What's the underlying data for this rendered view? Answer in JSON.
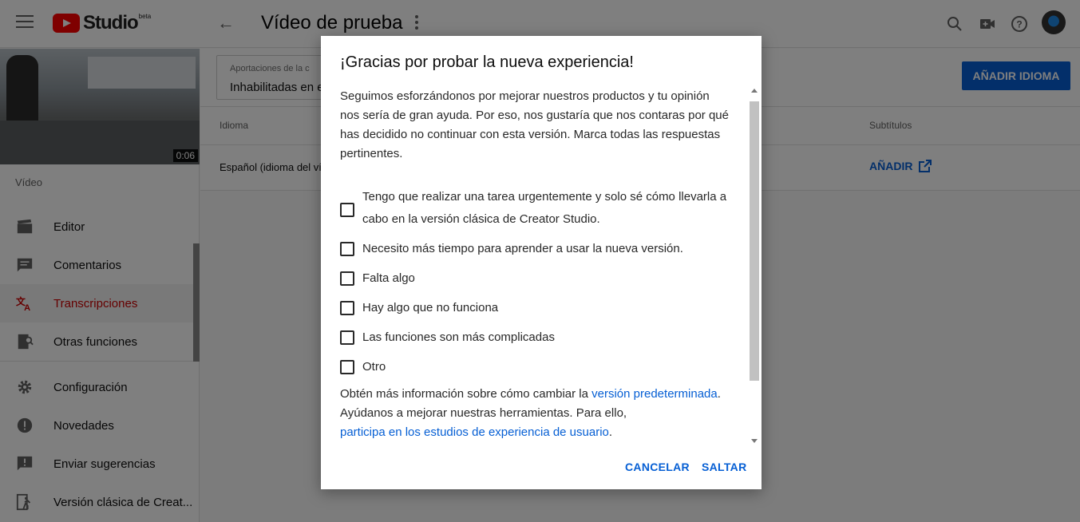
{
  "header": {
    "logo_text": "Studio",
    "logo_badge": "beta",
    "page_title": "Vídeo de prueba",
    "icons": [
      "menu-icon",
      "back-arrow-icon",
      "more-vert-icon",
      "search-icon",
      "create-video-icon",
      "help-icon",
      "avatar"
    ]
  },
  "sidebar": {
    "video_duration": "0:06",
    "section_label": "Vídeo",
    "items": [
      {
        "label": "Editor",
        "icon": "clapperboard-icon"
      },
      {
        "label": "Comentarios",
        "icon": "comment-icon"
      },
      {
        "label": "Transcripciones",
        "icon": "translate-icon",
        "active": true
      },
      {
        "label": "Otras funciones",
        "icon": "other-features-icon"
      },
      {
        "label": "Configuración",
        "icon": "gear-icon"
      },
      {
        "label": "Novedades",
        "icon": "new-badge-icon"
      },
      {
        "label": "Enviar sugerencias",
        "icon": "feedback-icon"
      },
      {
        "label": "Versión clásica de Creat...",
        "icon": "exit-classic-icon"
      }
    ]
  },
  "main": {
    "contributions_label": "Aportaciones de la c",
    "contributions_value": "Inhabilitadas en e",
    "add_language_button": "AÑADIR IDIOMA",
    "columns": {
      "language": "Idioma",
      "subtitles": "Subtítulos"
    },
    "row": {
      "language": "Español (idioma del ví",
      "action": "AÑADIR"
    }
  },
  "dialog": {
    "title": "¡Gracias por probar la nueva experiencia!",
    "intro": "Seguimos esforzándonos por mejorar nuestros productos y tu opinión nos sería de gran ayuda. Por eso, nos gustaría que nos contaras por qué has decidido no continuar con esta versión. Marca todas las respuestas pertinentes.",
    "options": [
      "Tengo que realizar una tarea urgentemente y solo sé cómo llevarla a cabo en la versión clásica de Creator Studio.",
      "Necesito más tiempo para aprender a usar la nueva versión.",
      "Falta algo",
      "Hay algo que no funciona",
      "Las funciones son más complicadas",
      "Otro"
    ],
    "info_prefix": "Obtén más información sobre cómo cambiar la ",
    "info_link": "versión predeterminada",
    "info_suffix": ".",
    "help_text": "Ayúdanos a mejorar nuestras herramientas. Para ello,",
    "study_link": "participa en los estudios de experiencia de usuario",
    "study_suffix": ".",
    "cancel_button": "CANCELAR",
    "skip_button": "SALTAR"
  },
  "colors": {
    "accent_blue": "#065fd4",
    "active_red": "#cc0000",
    "logo_red": "#ff0000"
  }
}
